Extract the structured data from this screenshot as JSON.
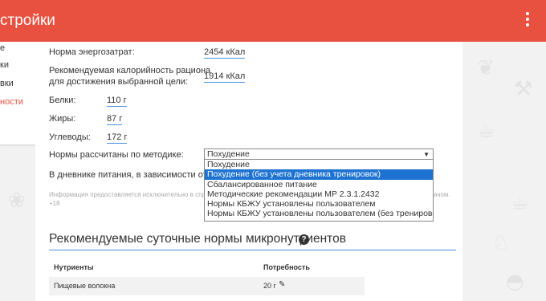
{
  "app": {
    "title": "стройки"
  },
  "sidebar": {
    "items": [
      {
        "label": "е",
        "active": false
      },
      {
        "label": "ки",
        "active": false
      },
      {
        "label": "вки",
        "active": false
      },
      {
        "label": "ности",
        "active": true
      }
    ]
  },
  "form": {
    "energy": {
      "label": "Норма энергозатрат:",
      "value": "2454 кКал"
    },
    "calories": {
      "label_line1": "Рекомендуемая калорийность рациона",
      "label_line2": "для достижения выбранной цели:",
      "value": "1914 кКал"
    },
    "protein": {
      "label": "Белки:",
      "value": "110 г"
    },
    "fat": {
      "label": "Жиры:",
      "value": "87 г"
    },
    "carbs": {
      "label": "Углеводы:",
      "value": "172 г"
    },
    "method": {
      "label": "Нормы рассчитаны по методике:",
      "selected": "Похудение",
      "options": [
        "Похудение",
        "Похудение (без учета дневника тренировок)",
        "Сбалансированное питание",
        "Методические рекомендации МР 2.3.1.2432",
        "Нормы КБЖУ установлены пользователем",
        "Нормы КБЖУ установлены пользователем (без тренировок)"
      ],
      "highlighted_index": 1
    },
    "diary_text": "В дневнике питания, в зависимости от ме",
    "info_text_1": "Информация предоставляется исключительно в спр",
    "info_text_1_tail": "ачом.",
    "info_text_2": "+18"
  },
  "micro": {
    "title": "Рекомендуемые суточные нормы микронутриентов",
    "columns": [
      "Нутриенты",
      "Потребность"
    ],
    "rows": [
      {
        "nutrient": "Пищевые волокна",
        "need": "20 г"
      }
    ]
  },
  "colors": {
    "accent": "#e8503f",
    "link_underline": "#4a90e2",
    "highlight": "#1e73d2"
  }
}
